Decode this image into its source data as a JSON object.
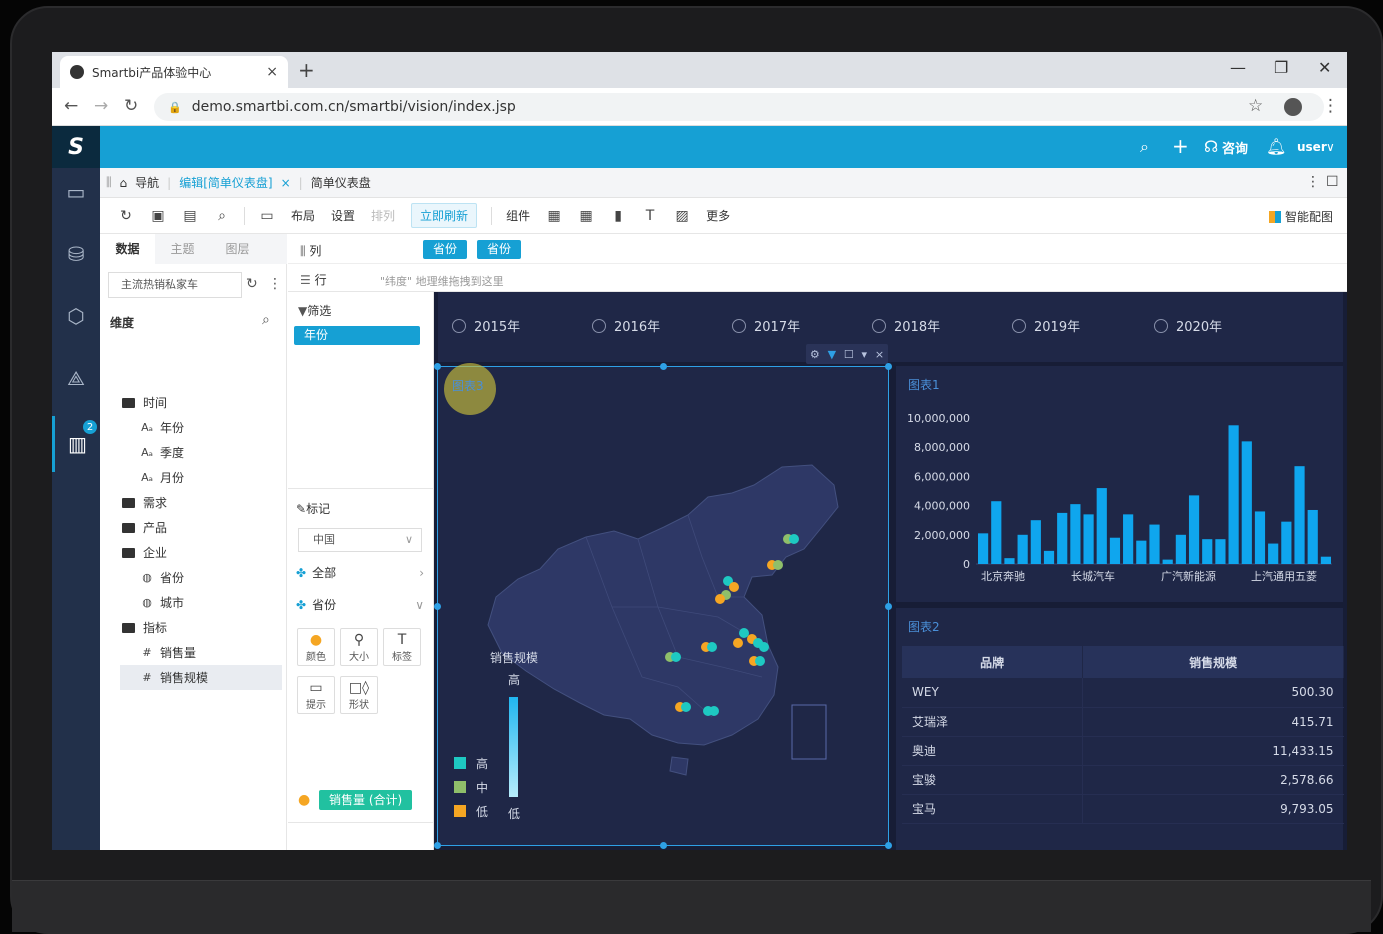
{
  "browser": {
    "tab_title": "Smartbi产品体验中心",
    "url": "demo.smartbi.com.cn/smartbi/vision/index.jsp"
  },
  "header": {
    "logo": "S",
    "consult": "咨询",
    "user": "user"
  },
  "rail": {
    "badge": "2"
  },
  "breadcrumbs": {
    "nav": "导航",
    "edit": "编辑[简单仪表盘]",
    "close": "×",
    "current": "简单仪表盘"
  },
  "toolbar": {
    "layout": "布局",
    "settings": "设置",
    "arrange": "排列",
    "refresh": "立即刷新",
    "components": "组件",
    "more": "更多",
    "smart": "智能配图"
  },
  "data_panel": {
    "tabs": [
      "数据",
      "主题",
      "图层"
    ],
    "dataset": "主流热销私家车",
    "dimension_head": "维度",
    "tree": [
      {
        "label": "时间",
        "type": "folder"
      },
      {
        "label": "年份",
        "type": "field"
      },
      {
        "label": "季度",
        "type": "field"
      },
      {
        "label": "月份",
        "type": "field"
      },
      {
        "label": "需求",
        "type": "folder"
      },
      {
        "label": "产品",
        "type": "folder"
      },
      {
        "label": "企业",
        "type": "folder"
      },
      {
        "label": "省份",
        "type": "geo"
      },
      {
        "label": "城市",
        "type": "geo"
      },
      {
        "label": "指标",
        "type": "folder"
      },
      {
        "label": "销售量",
        "type": "measure"
      },
      {
        "label": "销售规模",
        "type": "measure"
      }
    ]
  },
  "config": {
    "columns_label": "列",
    "rows_label": "行",
    "column_chips": [
      "省份",
      "省份"
    ],
    "rows_hint": "\"纬度\" 地理维拖拽到这里",
    "filter_label": "筛选",
    "filter_chip": "年份",
    "mark_label": "标记",
    "mark_type": "中国",
    "all_label": "全部",
    "province_label": "省份",
    "buttons": [
      "颜色",
      "大小",
      "标签",
      "提示",
      "形状"
    ],
    "measure_chip": "销售量 (合计)",
    "province_bottom": "省份"
  },
  "years": [
    "2015年",
    "2016年",
    "2017年",
    "2018年",
    "2019年",
    "2020年"
  ],
  "map_widget": {
    "title": "图表3",
    "legend_title": "销售规模",
    "legend_high": "高",
    "legend_low": "低",
    "categories": [
      "高",
      "中",
      "低"
    ],
    "colors": [
      "#1ec9c2",
      "#8fbf6a",
      "#f5a623"
    ]
  },
  "bar_widget": {
    "title": "图表1",
    "yticks": [
      "10,000,000",
      "8,000,000",
      "6,000,000",
      "4,000,000",
      "2,000,000",
      "0"
    ],
    "xlabels": [
      "北京奔驰",
      "长城汽车",
      "广汽新能源",
      "上汽通用五菱"
    ]
  },
  "chart_data": {
    "type": "bar",
    "title": "图表1",
    "ylim": [
      0,
      10000000
    ],
    "categories": [
      "北京奔驰",
      "长城汽车",
      "广汽新能源",
      "上汽通用五菱"
    ],
    "values": [
      2100000,
      4300000,
      400000,
      2000000,
      3000000,
      900000,
      3500000,
      4100000,
      3400000,
      5200000,
      1800000,
      3400000,
      1600000,
      2700000,
      300000,
      2000000,
      4700000,
      1700000,
      1700000,
      9500000,
      8400000,
      3600000,
      1400000,
      2900000,
      6700000,
      3700000,
      500000
    ],
    "color": "#0fa6ee"
  },
  "table_widget": {
    "title": "图表2",
    "headers": [
      "品牌",
      "销售规模"
    ],
    "rows": [
      [
        "WEY",
        "500.30"
      ],
      [
        "艾瑞泽",
        "415.71"
      ],
      [
        "奥迪",
        "11,433.15"
      ],
      [
        "宝骏",
        "2,578.66"
      ],
      [
        "宝马",
        "9,793.05"
      ]
    ]
  }
}
